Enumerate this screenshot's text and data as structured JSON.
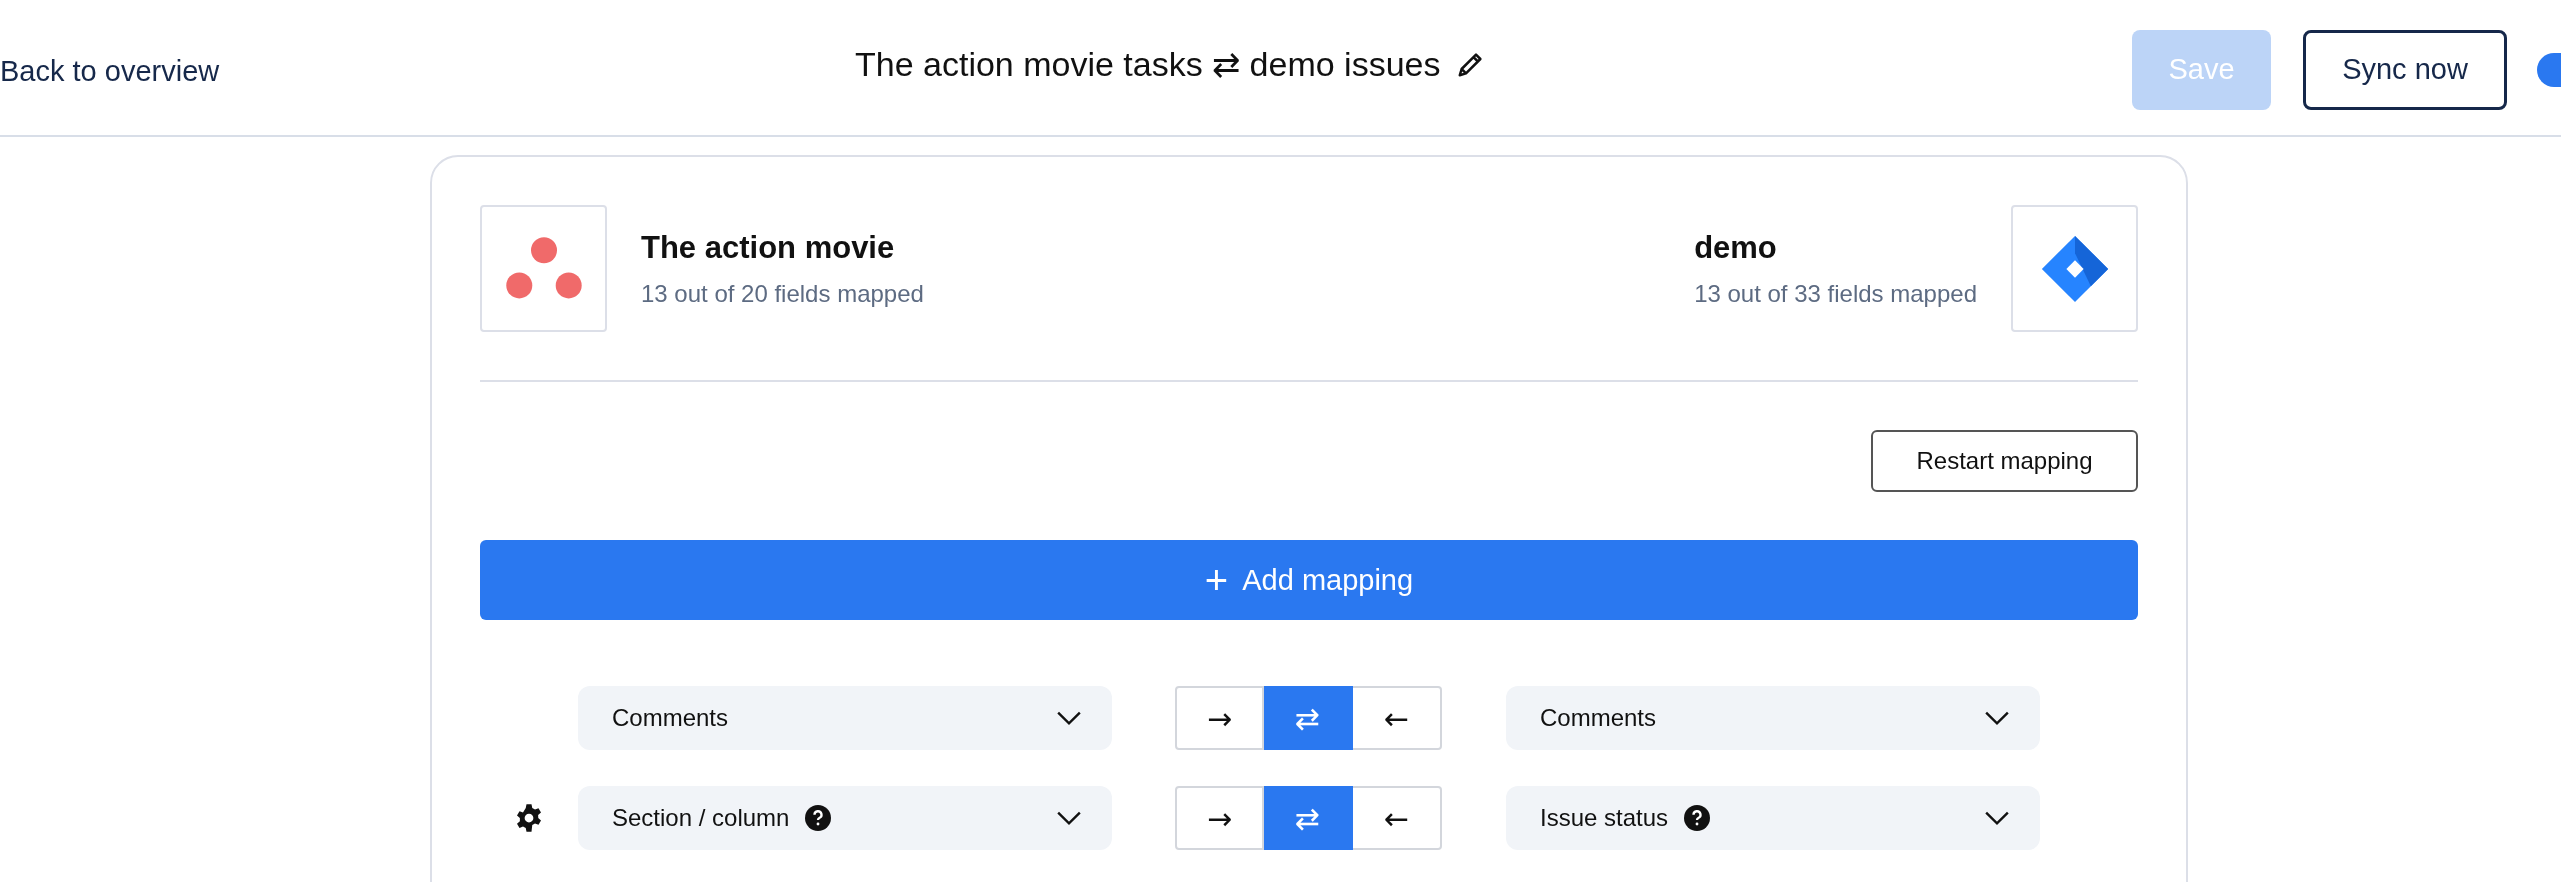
{
  "header": {
    "back_link": "Back to overview",
    "title": "The action movie tasks ⇄ demo issues",
    "buttons": [
      {
        "label": "Save",
        "kind": "primary",
        "disabled": true
      },
      {
        "label": "Sync now",
        "kind": "outline",
        "disabled": false
      }
    ]
  },
  "sources": [
    {
      "name": "The action movie",
      "summary": "13 out of 20 fields mapped",
      "kind": "asana"
    },
    {
      "name": "demo",
      "summary": "13 out of 33 fields mapped",
      "kind": "jira"
    }
  ],
  "restart_button": "Restart mapping",
  "add_mapping": {
    "icon": "+",
    "label": "Add mapping"
  },
  "mappings": [
    {
      "settings": false,
      "left": {
        "value": "Comments",
        "help": false
      },
      "directions": [
        {
          "symbol": "→",
          "selected": false
        },
        {
          "symbol": "⇄",
          "selected": true
        },
        {
          "symbol": "←",
          "selected": false
        }
      ],
      "right": {
        "value": "Comments",
        "help": false
      }
    },
    {
      "settings": true,
      "left": {
        "value": "Section / column",
        "help": true
      },
      "directions": [
        {
          "symbol": "→",
          "selected": false
        },
        {
          "symbol": "⇄",
          "selected": true
        },
        {
          "symbol": "←",
          "selected": false
        }
      ],
      "right": {
        "value": "Issue status",
        "help": true
      }
    }
  ]
}
